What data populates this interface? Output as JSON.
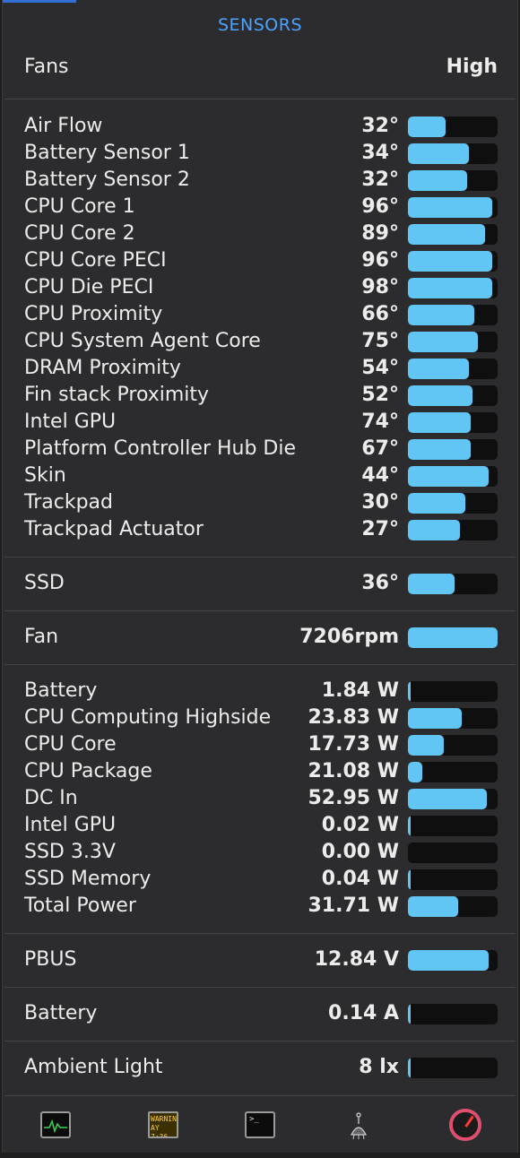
{
  "header": {
    "title": "SENSORS"
  },
  "fans": {
    "label": "Fans",
    "value": "High"
  },
  "temperatures": [
    {
      "name": "Air Flow",
      "value": "32°",
      "level": 0.42
    },
    {
      "name": "Battery Sensor 1",
      "value": "34°",
      "level": 0.68
    },
    {
      "name": "Battery Sensor 2",
      "value": "32°",
      "level": 0.66
    },
    {
      "name": "CPU Core 1",
      "value": "96°",
      "level": 0.94
    },
    {
      "name": "CPU Core 2",
      "value": "89°",
      "level": 0.86
    },
    {
      "name": "CPU Core PECI",
      "value": "96°",
      "level": 0.94
    },
    {
      "name": "CPU Die PECI",
      "value": "98°",
      "level": 0.94
    },
    {
      "name": "CPU Proximity",
      "value": "66°",
      "level": 0.74
    },
    {
      "name": "CPU System Agent Core",
      "value": "75°",
      "level": 0.78
    },
    {
      "name": "DRAM Proximity",
      "value": "54°",
      "level": 0.68
    },
    {
      "name": "Fin stack Proximity",
      "value": "52°",
      "level": 0.72
    },
    {
      "name": "Intel GPU",
      "value": "74°",
      "level": 0.7
    },
    {
      "name": "Platform Controller Hub Die",
      "value": "67°",
      "level": 0.7
    },
    {
      "name": "Skin",
      "value": "44°",
      "level": 0.9
    },
    {
      "name": "Trackpad",
      "value": "30°",
      "level": 0.64
    },
    {
      "name": "Trackpad Actuator",
      "value": "27°",
      "level": 0.58
    }
  ],
  "ssd": [
    {
      "name": "SSD",
      "value": "36°",
      "level": 0.52
    }
  ],
  "fan": [
    {
      "name": "Fan",
      "value": "7206rpm",
      "level": 1.0
    }
  ],
  "power": [
    {
      "name": "Battery",
      "value": "1.84 W",
      "level": 0.02
    },
    {
      "name": "CPU Computing Highside",
      "value": "23.83 W",
      "level": 0.6
    },
    {
      "name": "CPU Core",
      "value": "17.73 W",
      "level": 0.4
    },
    {
      "name": "CPU Package",
      "value": "21.08 W",
      "level": 0.16
    },
    {
      "name": "DC In",
      "value": "52.95 W",
      "level": 0.88
    },
    {
      "name": "Intel GPU",
      "value": "0.02 W",
      "level": 0.01
    },
    {
      "name": "SSD 3.3V",
      "value": "0.00 W",
      "level": 0.0
    },
    {
      "name": "SSD Memory",
      "value": "0.04 W",
      "level": 0.01
    },
    {
      "name": "Total Power",
      "value": "31.71 W",
      "level": 0.56
    }
  ],
  "voltage": [
    {
      "name": "PBUS",
      "value": "12.84 V",
      "level": 0.9
    }
  ],
  "current": [
    {
      "name": "Battery",
      "value": "0.14 A",
      "level": 0.01
    }
  ],
  "light": [
    {
      "name": "Ambient Light",
      "value": "8 lx",
      "level": 0.01
    }
  ],
  "footer": {
    "console_text": "WARNIN AY 7:36",
    "terminal_text": ">_",
    "icons": [
      "activity-monitor-icon",
      "console-icon",
      "terminal-icon",
      "cleaner-icon",
      "istat-menus-icon"
    ]
  },
  "colors": {
    "accent": "#4aa3ff",
    "bar_fill": "#62c6f5",
    "bar_track": "#0f0f10",
    "panel": "#2c2c2e"
  }
}
